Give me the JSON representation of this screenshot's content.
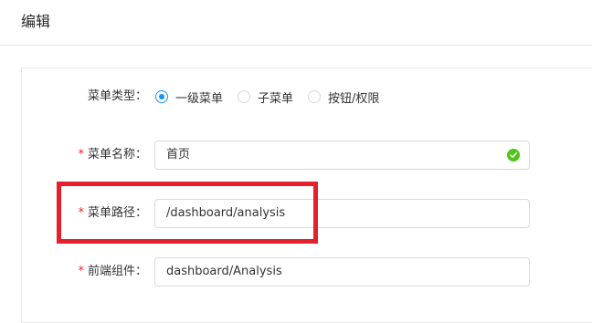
{
  "header": {
    "title": "编辑"
  },
  "form": {
    "menu_type": {
      "label": "菜单类型",
      "colon": "：",
      "options": [
        {
          "label": "一级菜单",
          "checked": true
        },
        {
          "label": "子菜单",
          "checked": false
        },
        {
          "label": "按钮/权限",
          "checked": false
        }
      ]
    },
    "menu_name": {
      "required_mark": "*",
      "label": "菜单名称",
      "colon": "：",
      "value": "首页",
      "status": "valid"
    },
    "menu_path": {
      "required_mark": "*",
      "label": "菜单路径",
      "colon": "：",
      "value": "/dashboard/analysis"
    },
    "frontend_component": {
      "required_mark": "*",
      "label": "前端组件",
      "colon": "：",
      "value": "dashboard/Analysis"
    }
  },
  "colors": {
    "primary": "#1890ff",
    "success": "#52c41a",
    "required": "#f5222d",
    "annotation": "#e3202c"
  }
}
